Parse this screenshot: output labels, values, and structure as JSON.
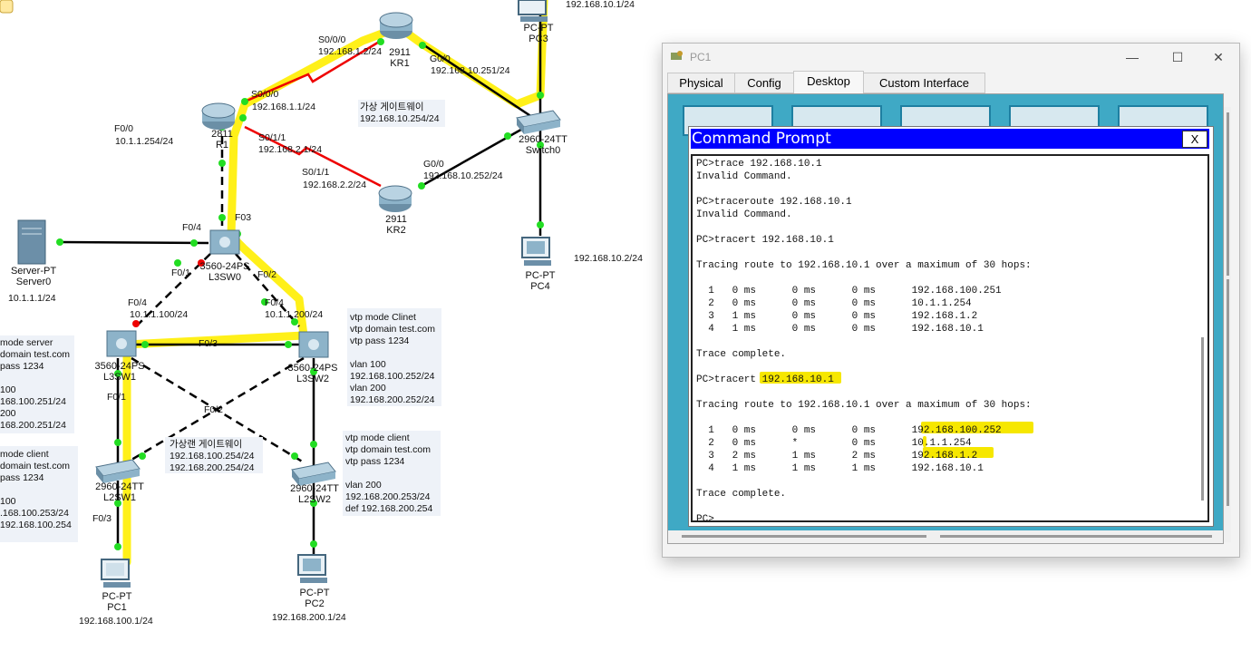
{
  "topology": {
    "devices": [
      {
        "id": "kr1",
        "model": "2911",
        "name": "KR1"
      },
      {
        "id": "r1",
        "model": "2811",
        "name": "R1"
      },
      {
        "id": "kr2",
        "model": "2911",
        "name": "KR2"
      },
      {
        "id": "pc3",
        "model": "PC-PT",
        "name": "PC3"
      },
      {
        "id": "switch0",
        "model": "2960-24TT",
        "name": "Switch0"
      },
      {
        "id": "pc4",
        "model": "PC-PT",
        "name": "PC4"
      },
      {
        "id": "server0",
        "model": "Server-PT",
        "name": "Server0"
      },
      {
        "id": "l3sw0",
        "model": "3560-24PS",
        "name": "L3SW0"
      },
      {
        "id": "l3sw1",
        "model": "3560-24PS",
        "name": "L3SW1"
      },
      {
        "id": "l3sw2",
        "model": "3560-24PS",
        "name": "L3SW2"
      },
      {
        "id": "l2sw1",
        "model": "2960-24TT",
        "name": "L2SW1"
      },
      {
        "id": "l2sw2",
        "model": "2960-24TT",
        "name": "L2SW2"
      },
      {
        "id": "pc1",
        "model": "PC-PT",
        "name": "PC1"
      },
      {
        "id": "pc2",
        "model": "PC-PT",
        "name": "PC2"
      }
    ],
    "labels": {
      "pc3_ip": "192.168.10.1/24",
      "kr1_s000": "S0/0/0",
      "kr1_s000_ip": "192.168.1.2/24",
      "kr1_g00": "G0/0",
      "kr1_g00_ip": "192.168.10.251/24",
      "r1_s000": "S0/0/0",
      "r1_s000_ip": "192.168.1.1/24",
      "r1_f00": "F0/0",
      "r1_f00_ip": "10.1.1.254/24",
      "r1_s011": "S0/1/1",
      "r1_s011_ip": "192.168.2.1/24",
      "kr2_s011": "S0/1/1",
      "kr2_s011_ip": "192.168.2.2/24",
      "kr2_g00": "G0/0",
      "kr2_g00_ip": "192.168.10.252/24",
      "vgw_title": "가상 게이트웨이",
      "vgw_ip": "192.168.10.254/24",
      "pc4_ip": "192.168.10.2/24",
      "f03": "F03",
      "f04_l3sw0": "F0/4",
      "server0_ip": "10.1.1.1/24",
      "l3sw0_f01": "F0/1",
      "l3sw0_f02": "F0/2",
      "l3sw1_f04": "F0/4",
      "l3sw1_f04_ip": "10.1.1.100/24",
      "l3sw2_f04": "F0/4",
      "l3sw2_f04_ip": "10.1.1.200/24",
      "f03_link": "F0/3",
      "l3sw1_f01": "F0/1",
      "f02_cross": "F0/2",
      "l2sw1_f03": "F0/3",
      "vgw2_title": "가상랜 게이트웨이",
      "vgw2_ip1": "192.168.100.254/24",
      "vgw2_ip2": "192.168.200.254/24",
      "pc1_ip": "192.168.100.1/24",
      "pc2_ip": "192.168.200.1/24"
    },
    "notes": {
      "l3sw1_cfg": [
        "mode server",
        "domain test.com",
        "pass 1234",
        "",
        "100",
        "168.100.251/24",
        "200",
        "168.200.251/24"
      ],
      "l2sw1_cfg": [
        "mode client",
        "domain test.com",
        "pass 1234",
        "",
        "100",
        ".168.100.253/24",
        "192.168.100.254"
      ],
      "l3sw2_cfg": [
        "vtp mode Clinet",
        "vtp domain test.com",
        "vtp pass 1234",
        "",
        "vlan 100",
        "192.168.100.252/24",
        "vlan 200",
        "192.168.200.252/24"
      ],
      "l2sw2_cfg": [
        "vtp mode client",
        "vtp domain test.com",
        "vtp pass 1234",
        "",
        "vlan 200",
        "192.168.200.253/24",
        "def 192.168.200.254"
      ]
    }
  },
  "window": {
    "title": "PC1",
    "controls": {
      "minimize": "—",
      "maximize": "☐",
      "close": "✕"
    },
    "tabs": [
      "Physical",
      "Config",
      "Desktop",
      "Custom Interface"
    ],
    "active_tab": "Desktop",
    "cmd_title": "Command Prompt",
    "cmd_close": "X",
    "terminal_lines": [
      "PC>trace 192.168.10.1",
      "Invalid Command.",
      "",
      "PC>traceroute 192.168.10.1",
      "Invalid Command.",
      "",
      "PC>tracert 192.168.10.1",
      "",
      "Tracing route to 192.168.10.1 over a maximum of 30 hops:",
      "",
      "  1   0 ms      0 ms      0 ms      192.168.100.251",
      "  2   0 ms      0 ms      0 ms      10.1.1.254",
      "  3   1 ms      0 ms      0 ms      192.168.1.2",
      "  4   1 ms      0 ms      0 ms      192.168.10.1",
      "",
      "Trace complete.",
      "",
      "PC>tracert 192.168.10.1",
      "",
      "Tracing route to 192.168.10.1 over a maximum of 30 hops:",
      "",
      "  1   0 ms      0 ms      0 ms      192.168.100.252",
      "  2   0 ms      *         0 ms      10.1.1.254",
      "  3   2 ms      1 ms      2 ms      192.168.1.2",
      "  4   1 ms      1 ms      1 ms      192.168.10.1",
      "",
      "Trace complete.",
      "",
      "PC>"
    ]
  }
}
